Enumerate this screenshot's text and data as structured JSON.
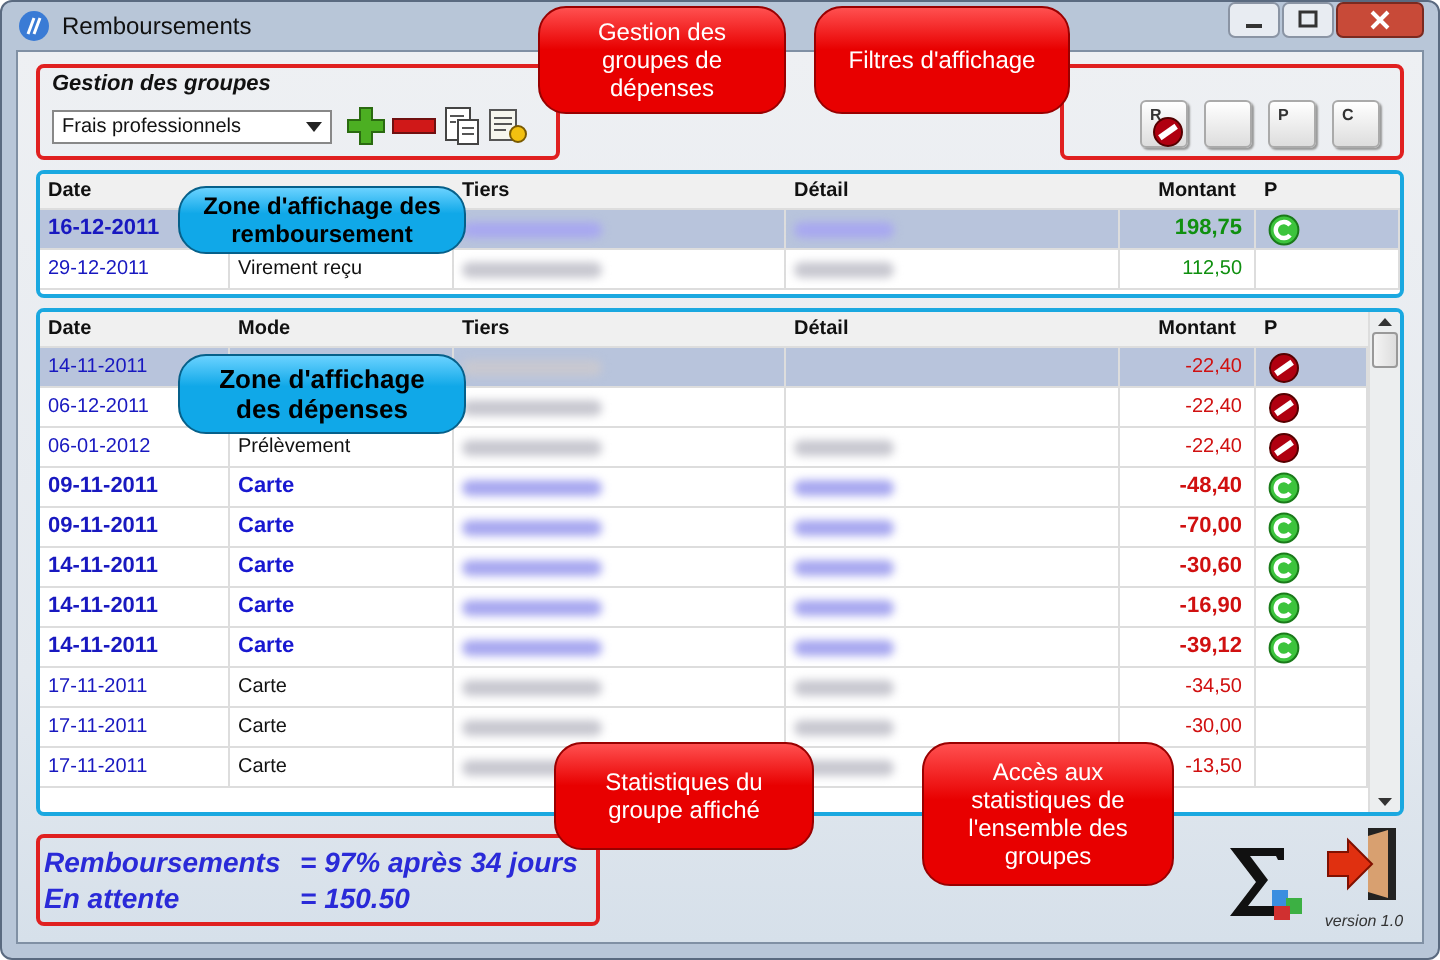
{
  "window": {
    "title": "Remboursements"
  },
  "groups": {
    "legend": "Gestion des groupes",
    "selected_group": "Frais professionnels"
  },
  "filters": [
    {
      "label": "R",
      "blocked": true
    },
    {
      "blocked": false
    },
    {
      "label": "P",
      "blocked": false
    },
    {
      "label": "C",
      "blocked": false
    }
  ],
  "refunds": {
    "columns": [
      {
        "label": "Date"
      },
      {},
      {
        "label": "Tiers"
      },
      {
        "label": "Détail"
      },
      {
        "label": "Montant"
      },
      {
        "label": "P"
      }
    ],
    "rows": [
      {
        "date": "16-12-2011",
        "tiers_redacted": true,
        "detail_redacted": true,
        "amount": "198,75",
        "bold": true,
        "selected": true,
        "kind": "check"
      },
      {
        "date": "29-12-2011",
        "mode": "Virement reçu",
        "tiers_redacted": true,
        "detail_redacted": true,
        "amount": "112,50",
        "bold": false,
        "selected": false,
        "kind": "plain"
      }
    ]
  },
  "expenses": {
    "columns": [
      {
        "label": "Date"
      },
      {
        "label": "Mode"
      },
      {
        "label": "Tiers"
      },
      {
        "label": "Détail"
      },
      {
        "label": "Montant"
      },
      {
        "label": "P"
      }
    ],
    "rows": [
      {
        "date": "14-11-2011",
        "tiers_redacted": true,
        "amount": "-22,40",
        "bold": false,
        "selected": true,
        "kind": "blocked"
      },
      {
        "date": "06-12-2011",
        "tiers_redacted": true,
        "amount": "-22,40",
        "bold": false,
        "selected": false,
        "kind": "blocked"
      },
      {
        "date": "06-01-2012",
        "mode": "Prélèvement",
        "tiers_redacted": true,
        "detail_redacted": true,
        "amount": "-22,40",
        "bold": false,
        "selected": false,
        "kind": "blocked"
      },
      {
        "date": "09-11-2011",
        "mode": "Carte",
        "tiers_redacted": true,
        "detail_redacted": true,
        "amount": "-48,40",
        "bold": true,
        "selected": false,
        "kind": "check"
      },
      {
        "date": "09-11-2011",
        "mode": "Carte",
        "tiers_redacted": true,
        "detail_redacted": true,
        "amount": "-70,00",
        "bold": true,
        "selected": false,
        "kind": "check"
      },
      {
        "date": "14-11-2011",
        "mode": "Carte",
        "tiers_redacted": true,
        "detail_redacted": true,
        "amount": "-30,60",
        "bold": true,
        "selected": false,
        "kind": "check"
      },
      {
        "date": "14-11-2011",
        "mode": "Carte",
        "tiers_redacted": true,
        "detail_redacted": true,
        "amount": "-16,90",
        "bold": true,
        "selected": false,
        "kind": "check"
      },
      {
        "date": "14-11-2011",
        "mode": "Carte",
        "tiers_redacted": true,
        "detail_redacted": true,
        "amount": "-39,12",
        "bold": true,
        "selected": false,
        "kind": "check"
      },
      {
        "date": "17-11-2011",
        "mode": "Carte",
        "tiers_redacted": true,
        "detail_redacted": true,
        "amount": "-34,50",
        "bold": false,
        "selected": false,
        "kind": "plain"
      },
      {
        "date": "17-11-2011",
        "mode": "Carte",
        "tiers_redacted": true,
        "detail_redacted": true,
        "amount": "-30,00",
        "bold": false,
        "selected": false,
        "kind": "plain"
      },
      {
        "date": "17-11-2011",
        "mode": "Carte",
        "tiers_redacted": true,
        "detail_redacted": true,
        "amount": "-13,50",
        "bold": false,
        "selected": false,
        "kind": "plain"
      }
    ]
  },
  "stats": [
    {
      "label": "Remboursements",
      "value": "= 97% après 34 jours"
    },
    {
      "label": "En attente",
      "value": "= 150.50"
    }
  ],
  "version": "version 1.0",
  "callouts": [
    {
      "kind": "red",
      "text": "Gestion des groupes de dépenses"
    },
    {
      "kind": "red",
      "text": "Filtres d'affichage"
    },
    {
      "kind": "blue",
      "text": "Zone d'affichage des remboursement"
    },
    {
      "kind": "blue",
      "text": "Zone d'affichage des dépenses"
    },
    {
      "kind": "red",
      "text": "Statistiques du groupe affiché"
    },
    {
      "kind": "red",
      "text": "Accès aux statistiques de l'ensemble des groupes"
    }
  ]
}
